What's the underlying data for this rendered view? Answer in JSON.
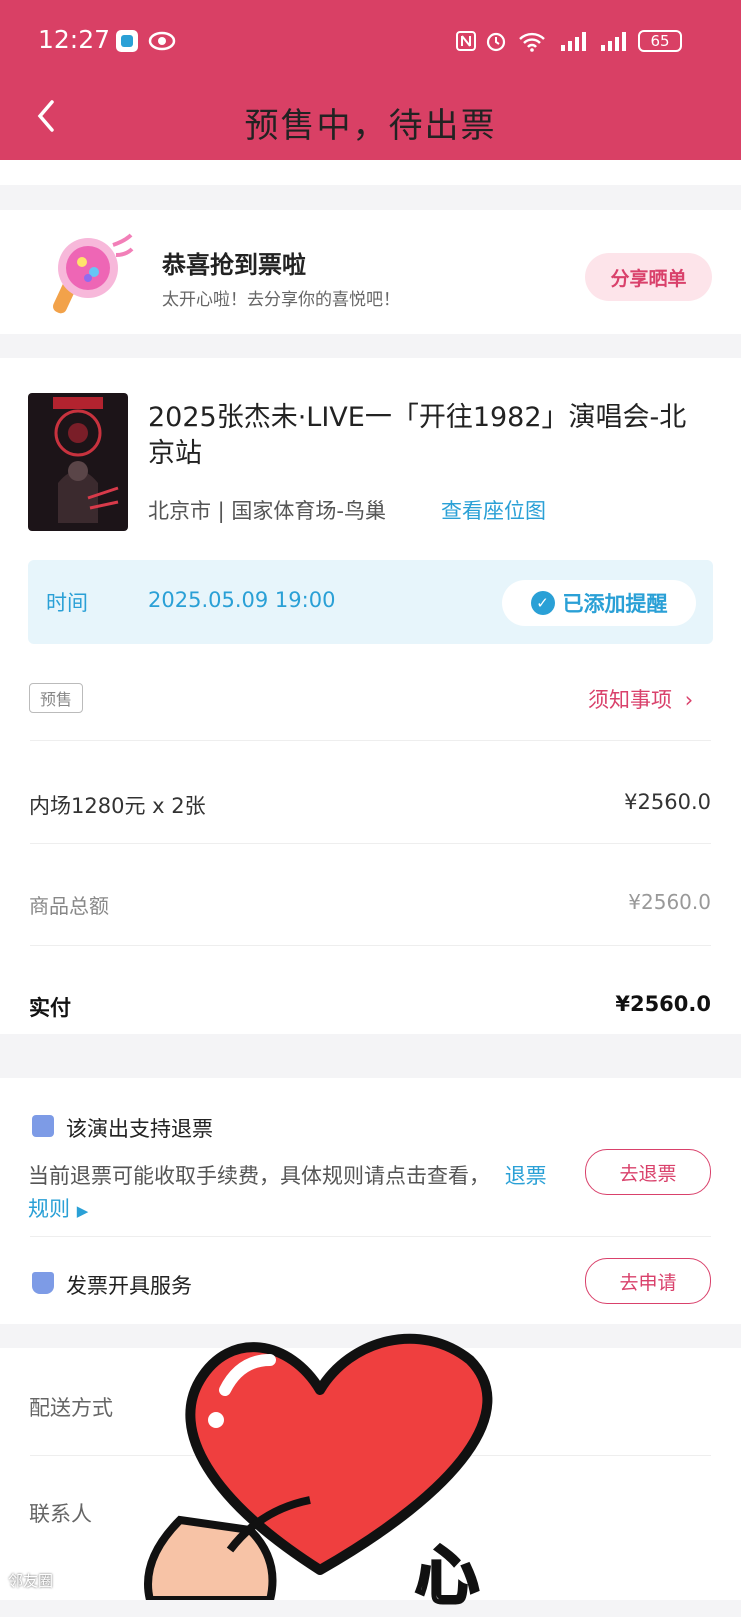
{
  "status_bar": {
    "time": "12:27",
    "battery": "65"
  },
  "nav": {
    "title": "预售中，待出票"
  },
  "congrats": {
    "title": "恭喜抢到票啦",
    "subtitle": "太开心啦！去分享你的喜悦吧！",
    "share_label": "分享晒单"
  },
  "event": {
    "title": "2025张杰未·LIVE一「开往1982」演唱会-北京站",
    "venue": "北京市 | 国家体育场-鸟巢",
    "seat_map_label": "查看座位图",
    "time_label": "时间",
    "time_value": "2025.05.09 19:00",
    "reminder_label": "已添加提醒"
  },
  "order": {
    "tag": "预售",
    "notice_label": "须知事项",
    "ticket_line": "内场1280元 x 2张",
    "ticket_amount": "¥2560.0",
    "total_label": "商品总额",
    "total_amount": "¥2560.0",
    "paid_label": "实付",
    "paid_amount": "¥2560.0"
  },
  "refund": {
    "title": "该演出支持退票",
    "desc": "当前退票可能收取手续费，具体规则请点击查看，",
    "rules_link": "退票规则",
    "button": "去退票"
  },
  "invoice": {
    "title": "发票开具服务",
    "button": "去申请"
  },
  "details": {
    "delivery_label": "配送方式",
    "contact_label": "联系人"
  },
  "sticker": {
    "text": "心"
  },
  "watermark": "邻友圈",
  "colors": {
    "brand": "#d94065",
    "accent_blue": "#2aa0d6",
    "pink_light": "#fde4ea"
  }
}
